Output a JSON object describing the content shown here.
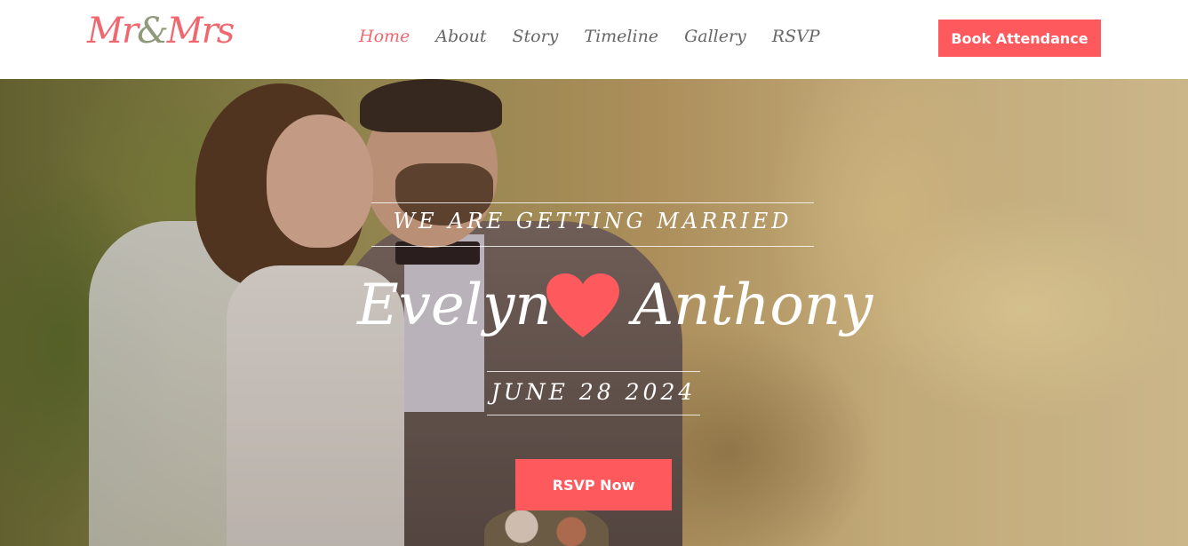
{
  "nav": {
    "logo": {
      "left": "Mr",
      "amp": "&",
      "right": "Mrs"
    },
    "menu": [
      {
        "label": "Home",
        "active": true
      },
      {
        "label": "About",
        "active": false
      },
      {
        "label": "Story",
        "active": false
      },
      {
        "label": "Timeline",
        "active": false
      },
      {
        "label": "Gallery",
        "active": false
      },
      {
        "label": "RSVP",
        "active": false
      }
    ],
    "cta_label": "Book Attendance"
  },
  "hero": {
    "tagline": "WE ARE GETTING MARRIED",
    "bride_name": "Evelyn",
    "groom_name": "Anthony",
    "heart_icon": "heart-icon",
    "date": "JUNE 28 2024",
    "cta_label": "RSVP Now"
  },
  "colors": {
    "accent": "#fe5a5e",
    "logo": "#f0686f",
    "logo_amp": "#8e9a7a",
    "menu_text": "#666666",
    "hero_text": "#ffffff"
  }
}
